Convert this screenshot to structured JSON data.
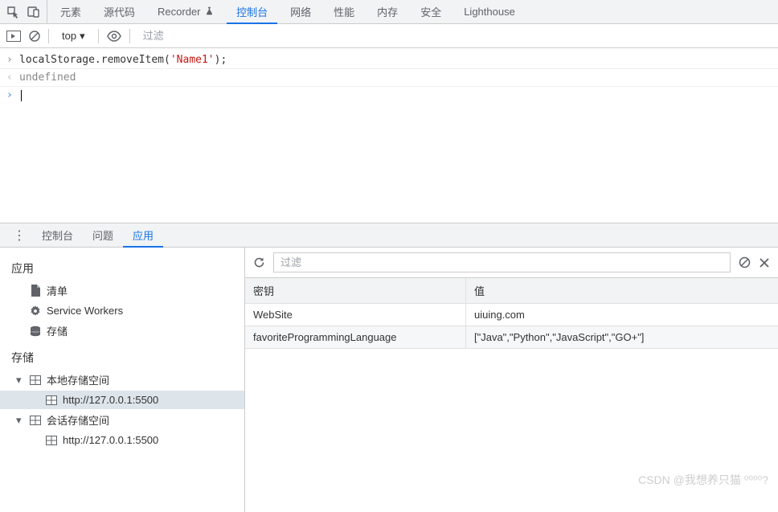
{
  "topTabs": {
    "elements": "元素",
    "sources": "源代码",
    "recorder": "Recorder",
    "console": "控制台",
    "network": "网络",
    "performance": "性能",
    "memory": "内存",
    "security": "安全",
    "lighthouse": "Lighthouse"
  },
  "consoleToolbar": {
    "context": "top",
    "filterPlaceholder": "过滤"
  },
  "consoleLines": {
    "input1_pre": "localStorage.removeItem(",
    "input1_str": "'Name1'",
    "input1_post": ");",
    "output1": "undefined"
  },
  "drawerTabs": {
    "console": "控制台",
    "issues": "问题",
    "application": "应用"
  },
  "sidebar": {
    "appSection": "应用",
    "manifest": "清单",
    "serviceWorkers": "Service Workers",
    "storage": "存储",
    "storageSection": "存储",
    "localStorage": "本地存储空间",
    "localStorageOrigin": "http://127.0.0.1:5500",
    "sessionStorage": "会话存储空间",
    "sessionStorageOrigin": "http://127.0.0.1:5500"
  },
  "rightPane": {
    "filterPlaceholder": "过滤",
    "headers": {
      "key": "密钥",
      "value": "值"
    },
    "rows": [
      {
        "key": "WebSite",
        "value": "uiuing.com"
      },
      {
        "key": "favoriteProgrammingLanguage",
        "value": "[\"Java\",\"Python\",\"JavaScript\",\"GO+\"]"
      }
    ]
  },
  "watermark": "CSDN @我想养只猫 ⁰⁰⁰⁰?"
}
